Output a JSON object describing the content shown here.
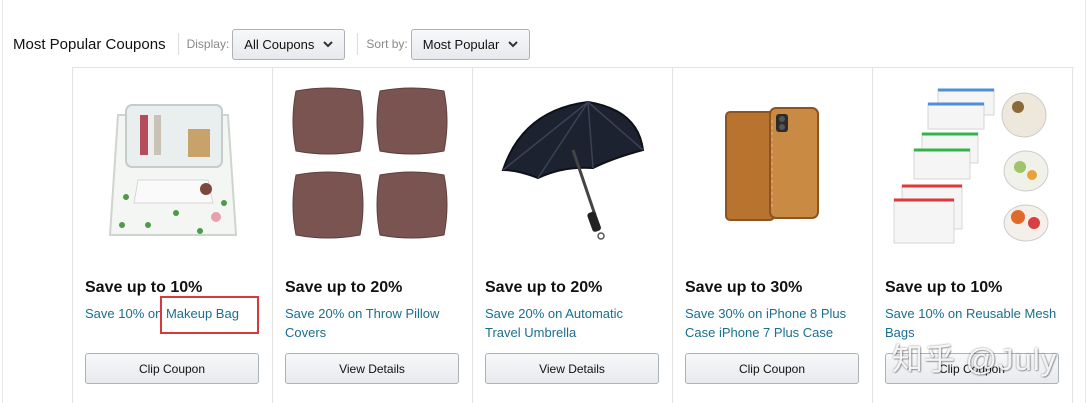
{
  "header": {
    "title": "Most Popular Coupons",
    "display_label": "Display:",
    "display_value": "All Coupons",
    "sort_label": "Sort by:",
    "sort_value": "Most Popular"
  },
  "coupons": [
    {
      "title": "Save up to 10%",
      "desc_lines": [
        "Save 10% on Makeup Bag"
      ],
      "button": "Clip Coupon",
      "image": "makeup-bag-image"
    },
    {
      "title": "Save up to 20%",
      "desc_lines": [
        "Save 20% on Throw Pillow",
        "Covers"
      ],
      "button": "View Details",
      "image": "throw-pillows-image"
    },
    {
      "title": "Save up to 20%",
      "desc_lines": [
        "Save 20% on Automatic",
        "Travel Umbrella"
      ],
      "button": "View Details",
      "image": "umbrella-image"
    },
    {
      "title": "Save up to 30%",
      "desc_lines": [
        "Save 30% on iPhone 8 Plus",
        "Case iPhone 7 Plus Case"
      ],
      "button": "Clip Coupon",
      "image": "phone-case-image"
    },
    {
      "title": "Save up to 10%",
      "desc_lines": [
        "Save 10% on Reusable Mesh",
        "Bags"
      ],
      "button": "Clip Coupon",
      "image": "mesh-bags-image"
    }
  ],
  "watermark": "知乎 @July",
  "colors": {
    "link": "#1a6e8e",
    "highlight": "#d63b3b"
  }
}
